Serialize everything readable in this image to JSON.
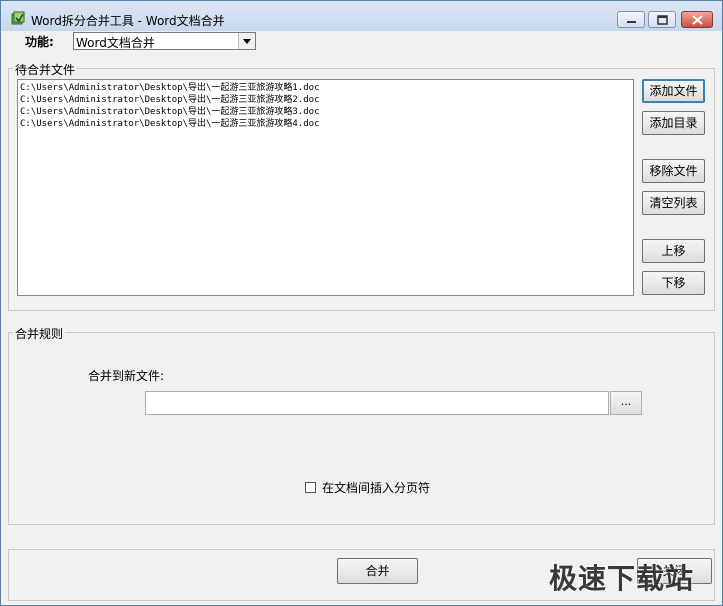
{
  "window": {
    "title": "Word拆分合并工具 - Word文档合并",
    "minimize_icon": "minimize-icon",
    "maximize_icon": "maximize-icon",
    "close_icon": "close-icon"
  },
  "function": {
    "label": "功能:",
    "selected": "Word文档合并"
  },
  "files_group": {
    "legend": "待合并文件",
    "files": [
      "C:\\Users\\Administrator\\Desktop\\导出\\一起游三亚旅游攻略1.doc",
      "C:\\Users\\Administrator\\Desktop\\导出\\一起游三亚旅游攻略2.doc",
      "C:\\Users\\Administrator\\Desktop\\导出\\一起游三亚旅游攻略3.doc",
      "C:\\Users\\Administrator\\Desktop\\导出\\一起游三亚旅游攻略4.doc"
    ],
    "buttons": {
      "add_file": "添加文件",
      "add_folder": "添加目录",
      "remove_file": "移除文件",
      "clear_list": "清空列表",
      "move_up": "上移",
      "move_down": "下移"
    }
  },
  "rules_group": {
    "legend": "合并规则",
    "merge_to_label": "合并到新文件:",
    "output_path": "",
    "browse_label": "...",
    "page_break_label": "在文档间插入分页符",
    "page_break_checked": false
  },
  "footer": {
    "merge_label": "合并",
    "close_label": "关闭"
  },
  "watermark": "极速下载站",
  "colors": {
    "titlebar": "#c7d8ee",
    "close_button": "#c7523f",
    "default_button_border": "#3c7fb1"
  }
}
